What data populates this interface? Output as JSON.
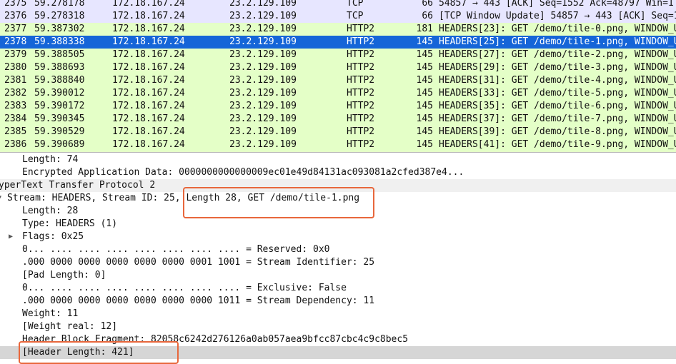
{
  "colors": {
    "tcp_row_bg": "#e7e6ff",
    "http2_row_bg": "#e4ffc7",
    "selected_row_bg": "#1565d8",
    "selected_row_text": "#ffffff",
    "protocol_section_bg": "#f0f0f0",
    "highlighted_row_bg": "#d6d6d6",
    "annotation_box": "#e8673c"
  },
  "packets": [
    {
      "no": "2375",
      "time": "59.278178",
      "src": "172.18.167.24",
      "dst": "23.2.129.109",
      "proto": "TCP",
      "len": "66",
      "info": "54857 → 443 [ACK] Seq=1552 Ack=48797 Win=1",
      "kind": "tcp",
      "selected": false
    },
    {
      "no": "2376",
      "time": "59.278318",
      "src": "172.18.167.24",
      "dst": "23.2.129.109",
      "proto": "TCP",
      "len": "66",
      "info": "[TCP Window Update] 54857 → 443 [ACK] Seq=1",
      "kind": "tcp",
      "selected": false
    },
    {
      "no": "2377",
      "time": "59.387302",
      "src": "172.18.167.24",
      "dst": "23.2.129.109",
      "proto": "HTTP2",
      "len": "181",
      "info": "HEADERS[23]: GET /demo/tile-0.png, WINDOW_U",
      "kind": "http2",
      "selected": false
    },
    {
      "no": "2378",
      "time": "59.388338",
      "src": "172.18.167.24",
      "dst": "23.2.129.109",
      "proto": "HTTP2",
      "len": "145",
      "info": "HEADERS[25]: GET /demo/tile-1.png, WINDOW_U",
      "kind": "http2",
      "selected": true
    },
    {
      "no": "2379",
      "time": "59.388505",
      "src": "172.18.167.24",
      "dst": "23.2.129.109",
      "proto": "HTTP2",
      "len": "145",
      "info": "HEADERS[27]: GET /demo/tile-2.png, WINDOW_U",
      "kind": "http2",
      "selected": false
    },
    {
      "no": "2380",
      "time": "59.388693",
      "src": "172.18.167.24",
      "dst": "23.2.129.109",
      "proto": "HTTP2",
      "len": "145",
      "info": "HEADERS[29]: GET /demo/tile-3.png, WINDOW_U",
      "kind": "http2",
      "selected": false
    },
    {
      "no": "2381",
      "time": "59.388840",
      "src": "172.18.167.24",
      "dst": "23.2.129.109",
      "proto": "HTTP2",
      "len": "145",
      "info": "HEADERS[31]: GET /demo/tile-4.png, WINDOW_U",
      "kind": "http2",
      "selected": false
    },
    {
      "no": "2382",
      "time": "59.390012",
      "src": "172.18.167.24",
      "dst": "23.2.129.109",
      "proto": "HTTP2",
      "len": "145",
      "info": "HEADERS[33]: GET /demo/tile-5.png, WINDOW_U",
      "kind": "http2",
      "selected": false
    },
    {
      "no": "2383",
      "time": "59.390172",
      "src": "172.18.167.24",
      "dst": "23.2.129.109",
      "proto": "HTTP2",
      "len": "145",
      "info": "HEADERS[35]: GET /demo/tile-6.png, WINDOW_U",
      "kind": "http2",
      "selected": false
    },
    {
      "no": "2384",
      "time": "59.390345",
      "src": "172.18.167.24",
      "dst": "23.2.129.109",
      "proto": "HTTP2",
      "len": "145",
      "info": "HEADERS[37]: GET /demo/tile-7.png, WINDOW_U",
      "kind": "http2",
      "selected": false
    },
    {
      "no": "2385",
      "time": "59.390529",
      "src": "172.18.167.24",
      "dst": "23.2.129.109",
      "proto": "HTTP2",
      "len": "145",
      "info": "HEADERS[39]: GET /demo/tile-8.png, WINDOW_U",
      "kind": "http2",
      "selected": false
    },
    {
      "no": "2386",
      "time": "59.390689",
      "src": "172.18.167.24",
      "dst": "23.2.129.109",
      "proto": "HTTP2",
      "len": "145",
      "info": "HEADERS[41]: GET /demo/tile-9.png, WINDOW_U",
      "kind": "http2",
      "selected": false
    }
  ],
  "details": [
    {
      "text": "Length: 74",
      "indent": 2,
      "expander": "none",
      "style": "normal"
    },
    {
      "text": "Encrypted Application Data: 0000000000000009ec01e49d84131ac093081a2cfed387e4...",
      "indent": 2,
      "expander": "none",
      "style": "normal"
    },
    {
      "text": "yperText Transfer Protocol 2",
      "indent": 0,
      "expander": "none",
      "style": "section"
    },
    {
      "text": "Stream: HEADERS, Stream ID: 25, Length 28, GET /demo/tile-1.png",
      "indent": 1,
      "expander": "expanded",
      "style": "normal"
    },
    {
      "text": "Length: 28",
      "indent": 2,
      "expander": "none",
      "style": "normal"
    },
    {
      "text": "Type: HEADERS (1)",
      "indent": 2,
      "expander": "none",
      "style": "normal"
    },
    {
      "text": "Flags: 0x25",
      "indent": 2,
      "expander": "collapsed",
      "style": "normal"
    },
    {
      "text": "0... .... .... .... .... .... .... .... = Reserved: 0x0",
      "indent": 2,
      "expander": "none",
      "style": "normal"
    },
    {
      "text": ".000 0000 0000 0000 0000 0000 0001 1001 = Stream Identifier: 25",
      "indent": 2,
      "expander": "none",
      "style": "normal"
    },
    {
      "text": "[Pad Length: 0]",
      "indent": 2,
      "expander": "none",
      "style": "normal"
    },
    {
      "text": "0... .... .... .... .... .... .... .... = Exclusive: False",
      "indent": 2,
      "expander": "none",
      "style": "normal"
    },
    {
      "text": ".000 0000 0000 0000 0000 0000 0000 1011 = Stream Dependency: 11",
      "indent": 2,
      "expander": "none",
      "style": "normal"
    },
    {
      "text": "Weight: 11",
      "indent": 2,
      "expander": "none",
      "style": "normal"
    },
    {
      "text": "[Weight real: 12]",
      "indent": 2,
      "expander": "none",
      "style": "normal"
    },
    {
      "text": "Header Block Fragment: 82058c6242d276126a0ab057aea9bfcc87cbc4c9c8bec5",
      "indent": 2,
      "expander": "none",
      "style": "normal"
    },
    {
      "text": "[Header Length: 421]",
      "indent": 2,
      "expander": "none",
      "style": "highlighted"
    }
  ]
}
